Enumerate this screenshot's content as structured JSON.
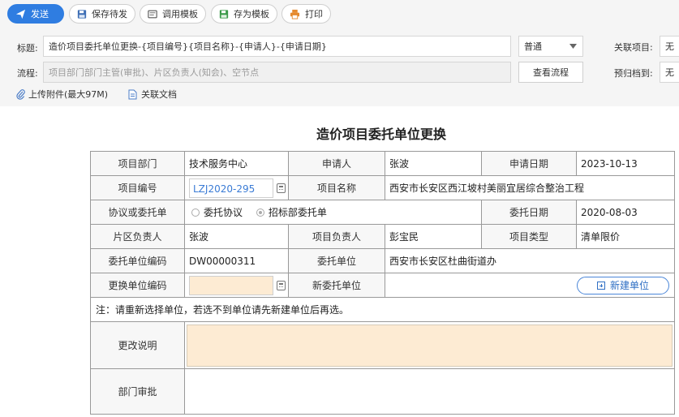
{
  "toolbar": {
    "send": "发送",
    "save_draft": "保存待发",
    "use_template": "调用模板",
    "save_template": "存为模板",
    "print": "打印"
  },
  "header": {
    "subject_label": "标题:",
    "subject_value": "造价项目委托单位更换-{项目编号}{项目名称}-{申请人}-{申请日期}",
    "priority_value": "普通",
    "related_project_label": "关联项目:",
    "related_project_value": "无",
    "flow_label": "流程:",
    "flow_placeholder": "项目部门部门主管(审批)、片区负责人(知会)、空节点",
    "view_flow": "查看流程",
    "archive_label": "预归档到:",
    "archive_value": "无",
    "upload": "上传附件(最大97M)",
    "related_doc": "关联文档"
  },
  "form": {
    "title": "造价项目委托单位更换",
    "dept_label": "项目部门",
    "dept_value": "技术服务中心",
    "applicant_label": "申请人",
    "applicant_value": "张波",
    "apply_date_label": "申请日期",
    "apply_date_value": "2023-10-13",
    "proj_no_label": "项目编号",
    "proj_no_value": "LZJ2020-295",
    "proj_name_label": "项目名称",
    "proj_name_value": "西安市长安区西江坡村美丽宜居综合整治工程",
    "agreement_label": "协议或委托单",
    "opt_agreement": "委托协议",
    "opt_bidding": "招标部委托单",
    "commission_date_label": "委托日期",
    "commission_date_value": "2020-08-03",
    "area_lead_label": "片区负责人",
    "area_lead_value": "张波",
    "proj_lead_label": "项目负责人",
    "proj_lead_value": "彭宝民",
    "proj_type_label": "项目类型",
    "proj_type_value": "清单限价",
    "client_code_label": "委托单位编码",
    "client_code_value": "DW00000311",
    "client_label": "委托单位",
    "client_value": "西安市长安区杜曲街道办",
    "change_code_label": "更换单位编码",
    "new_client_label": "新委托单位",
    "new_unit_button": "新建单位",
    "note": "注：请重新选择单位，若选不到单位请先新建单位后再选。",
    "change_desc_label": "更改说明",
    "dept_approval_label": "部门审批"
  }
}
